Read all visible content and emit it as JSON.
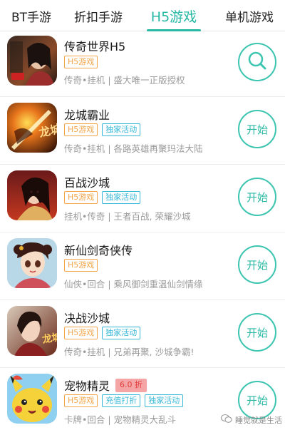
{
  "tabs": [
    {
      "label": "BT手游",
      "active": false
    },
    {
      "label": "折扣手游",
      "active": false
    },
    {
      "label": "H5游戏",
      "active": true
    },
    {
      "label": "单机游戏",
      "active": false
    }
  ],
  "games": [
    {
      "title": "传奇世界H5",
      "tags": [
        "H5游戏"
      ],
      "desc": "传奇•挂机 | 盛大唯一正版授权",
      "icon_name": "legend-world-icon"
    },
    {
      "title": "龙城霸业",
      "tags": [
        "H5游戏",
        "独家活动"
      ],
      "desc": "传奇•挂机 | 各路英雄再聚玛法大陆",
      "icon_name": "dragon-city-icon",
      "icon_text": "龙城"
    },
    {
      "title": "百战沙城",
      "tags": [
        "H5游戏",
        "独家活动"
      ],
      "desc": "挂机•传奇 | 王者百战, 荣耀沙城",
      "icon_name": "sand-city-icon"
    },
    {
      "title": "新仙剑奇侠传",
      "tags": [
        "H5游戏"
      ],
      "desc": "仙侠•回合 | 乘风御剑重温仙剑情缘",
      "icon_name": "sword-fairy-icon"
    },
    {
      "title": "决战沙城",
      "tags": [
        "H5游戏",
        "独家活动"
      ],
      "desc": "传奇•挂机 | 兄弟再聚, 沙城争霸!",
      "icon_name": "decisive-battle-icon",
      "icon_text": "龙城"
    },
    {
      "title": "宠物精灵",
      "discount": "6.0 折",
      "tags": [
        "H5游戏",
        "充值打折",
        "独家活动"
      ],
      "desc": "卡牌•回合 | 宠物精灵大乱斗",
      "icon_name": "pet-elf-icon"
    }
  ],
  "start_label": "开始",
  "watermark": "睡觉就是生活"
}
